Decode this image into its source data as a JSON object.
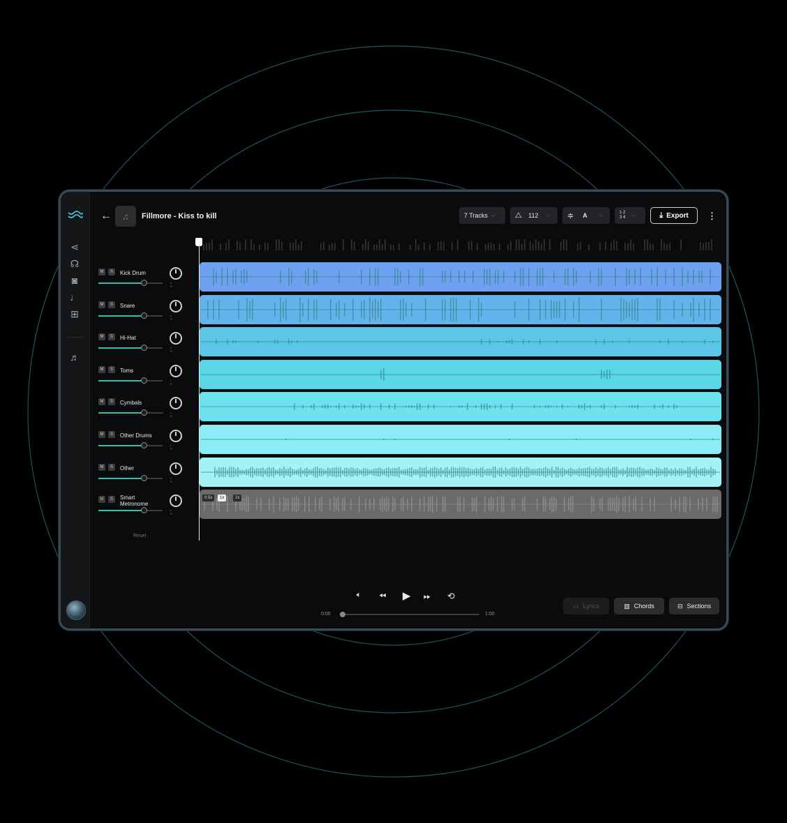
{
  "app": {
    "logo_icon": "wave-logo-icon"
  },
  "sidebar": {
    "items": [
      {
        "name": "share-icon",
        "glyph": "⋖"
      },
      {
        "name": "voice-icon",
        "glyph": "☊"
      },
      {
        "name": "speaker-icon",
        "glyph": "◙"
      },
      {
        "name": "tune-icon",
        "glyph": "♩"
      },
      {
        "name": "grid-icon",
        "glyph": "⊞"
      },
      {
        "name": "playlist-icon",
        "glyph": "♬"
      }
    ]
  },
  "header": {
    "title": "Fillmore - Kiss to kill",
    "tracks_label": "7 Tracks",
    "bpm": "112",
    "key": "A",
    "time_sig": "1 2 3 4",
    "export_label": "Export"
  },
  "tracks": [
    {
      "name": "Kick Drum",
      "mute": "M",
      "solo": "S",
      "color": "#6ea1f0"
    },
    {
      "name": "Snare",
      "mute": "M",
      "solo": "S",
      "color": "#64b3ec"
    },
    {
      "name": "Hi-Hat",
      "mute": "M",
      "solo": "S",
      "color": "#5cc6e6"
    },
    {
      "name": "Toms",
      "mute": "M",
      "solo": "S",
      "color": "#5ad6e6"
    },
    {
      "name": "Cymbals",
      "mute": "M",
      "solo": "S",
      "color": "#6ee3ee"
    },
    {
      "name": "Other Drums",
      "mute": "M",
      "solo": "S",
      "color": "#8cecf5"
    },
    {
      "name": "Other",
      "mute": "M",
      "solo": "S",
      "color": "#a4f1f7"
    },
    {
      "name": "Smart Metronome",
      "mute": "M",
      "solo": "S",
      "color": "#6a6a6a"
    }
  ],
  "metronome_speeds": [
    "0.5x",
    "1x",
    "2x"
  ],
  "knob_lr": "L R",
  "reset_label": "Reset",
  "transport": {
    "time_start": "0:00",
    "time_end": "1:00",
    "progress": 0
  },
  "bottom_buttons": {
    "lyrics": "Lyrics",
    "chords": "Chords",
    "sections": "Sections"
  }
}
